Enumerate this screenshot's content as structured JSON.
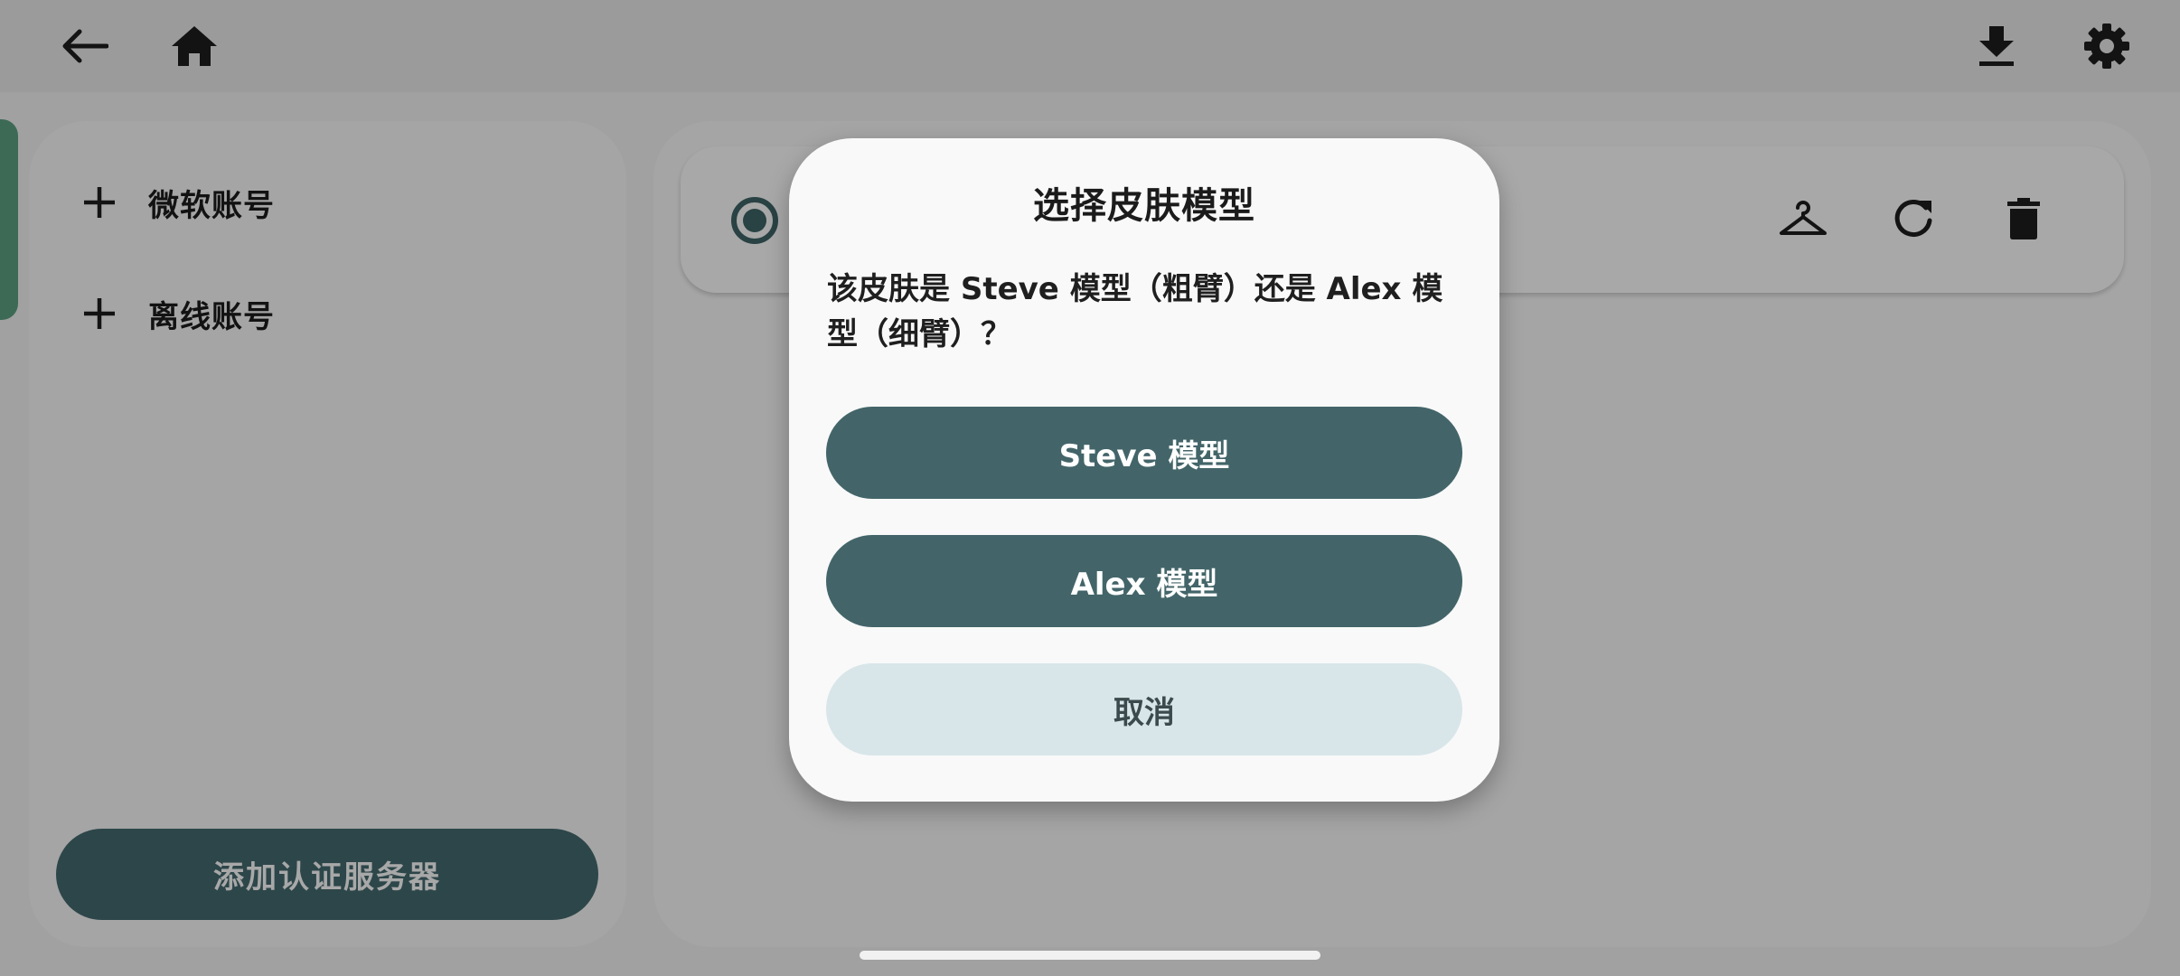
{
  "topbar": {
    "back_icon": "arrow-left-icon",
    "home_icon": "home-icon",
    "download_icon": "download-icon",
    "settings_icon": "gear-icon"
  },
  "left_panel": {
    "items": [
      {
        "label": "微软账号",
        "icon": "plus-icon"
      },
      {
        "label": "离线账号",
        "icon": "plus-icon"
      }
    ],
    "auth_button_label": "添加认证服务器"
  },
  "account_card": {
    "selected": true,
    "actions": [
      "hanger-icon",
      "refresh-icon",
      "trash-icon"
    ]
  },
  "dialog": {
    "title": "选择皮肤模型",
    "message": "该皮肤是 Steve 模型（粗臂）还是 Alex 模型（细臂）？",
    "steve_button": "Steve 模型",
    "alex_button": "Alex 模型",
    "cancel_button": "取消"
  },
  "colors": {
    "primary": "#436569",
    "cancel_bg": "#d8e6e9",
    "scrim": "rgba(0,0,0,0.34)"
  }
}
